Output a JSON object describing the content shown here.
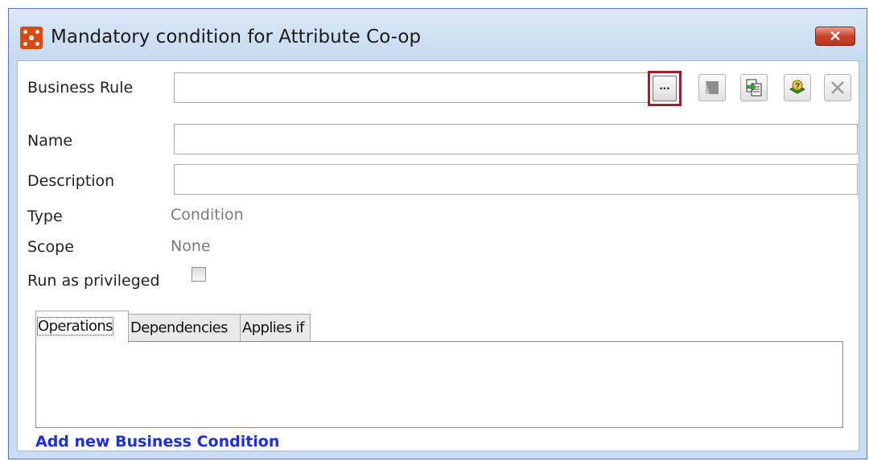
{
  "window": {
    "title": "Mandatory condition for Attribute Co-op",
    "close_label": "✕"
  },
  "form": {
    "business_rule": {
      "label": "Business Rule",
      "value": "",
      "browse_label": "..."
    },
    "name": {
      "label": "Name",
      "value": ""
    },
    "description": {
      "label": "Description",
      "value": ""
    },
    "type": {
      "label": "Type",
      "value": "Condition"
    },
    "scope": {
      "label": "Scope",
      "value": "None"
    },
    "run_as_privileged": {
      "label": "Run as privileged",
      "checked": false
    }
  },
  "toolbar": [
    {
      "name": "edit-rule-icon"
    },
    {
      "name": "copy-rule-icon"
    },
    {
      "name": "help-rule-icon"
    },
    {
      "name": "remove-rule-icon"
    }
  ],
  "tabs": [
    {
      "label": "Operations"
    },
    {
      "label": "Dependencies"
    },
    {
      "label": "Applies if"
    }
  ],
  "add_link": "Add new Business Condition"
}
